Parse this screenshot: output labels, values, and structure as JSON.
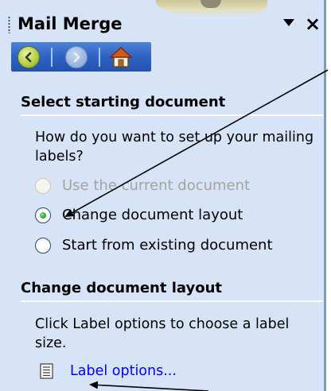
{
  "pane": {
    "title": "Mail Merge",
    "menu_icon": "dropdown-arrow-icon",
    "close_icon": "close-icon",
    "nav": {
      "back_icon": "back-arrow-icon",
      "forward_icon": "forward-arrow-icon",
      "home_icon": "home-icon"
    }
  },
  "section_start": {
    "heading": "Select starting document",
    "question": "How do you want to set up your mailing labels?",
    "options": [
      {
        "label": "Use the current document",
        "state": "disabled"
      },
      {
        "label": "Change document layout",
        "state": "selected"
      },
      {
        "label": "Start from existing document",
        "state": "unselected"
      }
    ]
  },
  "section_layout": {
    "heading": "Change document layout",
    "description": "Click Label options to choose a label size.",
    "link_label": "Label options...",
    "link_icon": "document-icon"
  },
  "colors": {
    "pane_background": "#d7e3f6",
    "nav_bar": "#2d62c4",
    "link": "#0000ff",
    "radio_selected": "#21a121"
  }
}
